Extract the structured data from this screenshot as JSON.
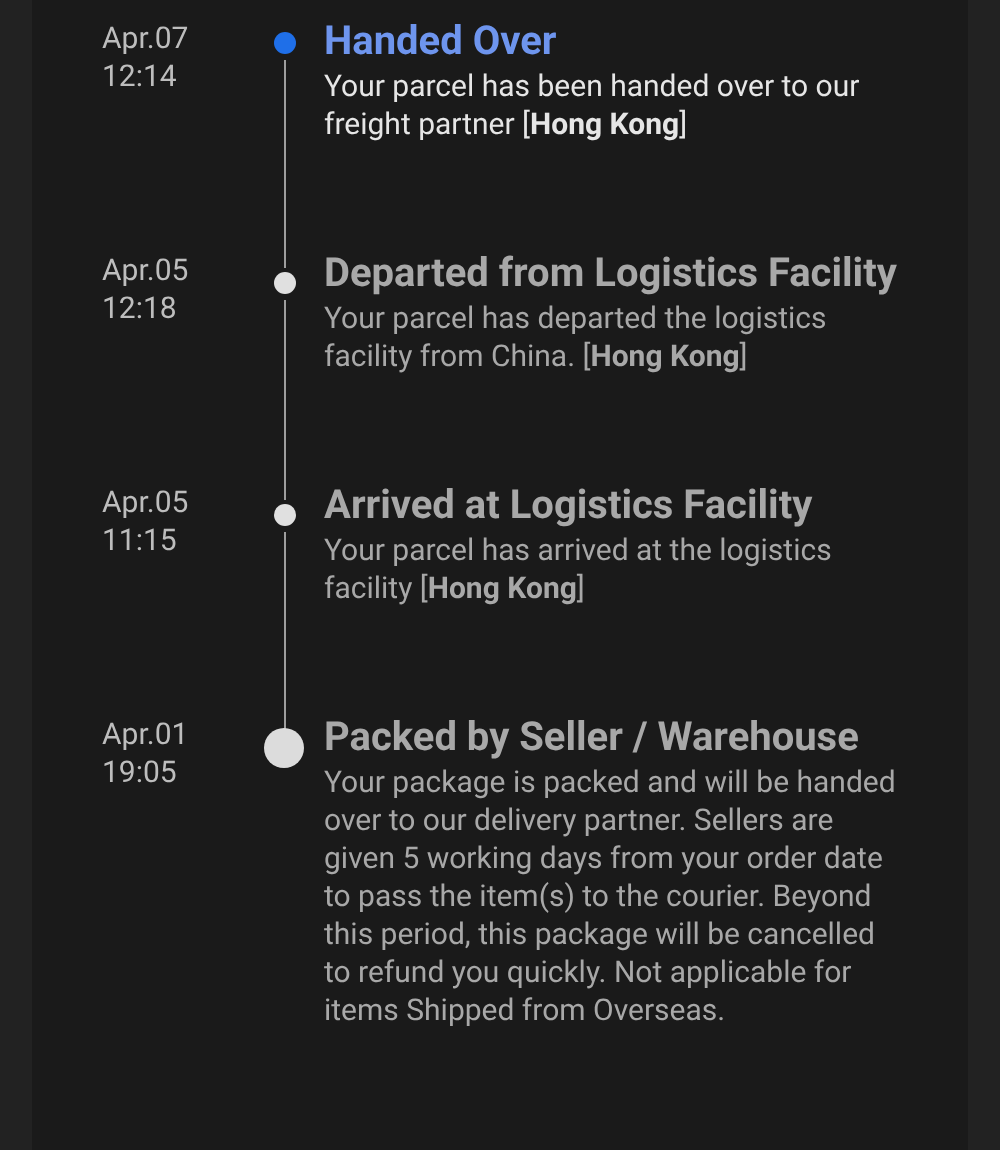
{
  "events": [
    {
      "kind": "current",
      "date": "Apr.07",
      "time": "12:14",
      "title": "Handed Over",
      "text": "Your parcel has been handed over to our freight partner [**Hong Kong**]"
    },
    {
      "kind": "past",
      "date": "Apr.05",
      "time": "12:18",
      "title": "Departed from Logistics Facility",
      "text": "Your parcel has departed the logistics facility from China. [**Hong Kong**]"
    },
    {
      "kind": "past",
      "date": "Apr.05",
      "time": "11:15",
      "title": "Arrived at Logistics Facility",
      "text": "Your parcel has arrived at the logistics facility [**Hong Kong**]"
    },
    {
      "kind": "origin",
      "date": "Apr.01",
      "time": "19:05",
      "title": "Packed by Seller / Warehouse",
      "text": "Your package is packed and will be handed over to our delivery partner. Sellers are given 5 working days from your order date to pass the item(s) to the courier. Beyond this period, this package will be cancelled to refund you quickly. Not applicable for items Shipped from Overseas."
    }
  ]
}
